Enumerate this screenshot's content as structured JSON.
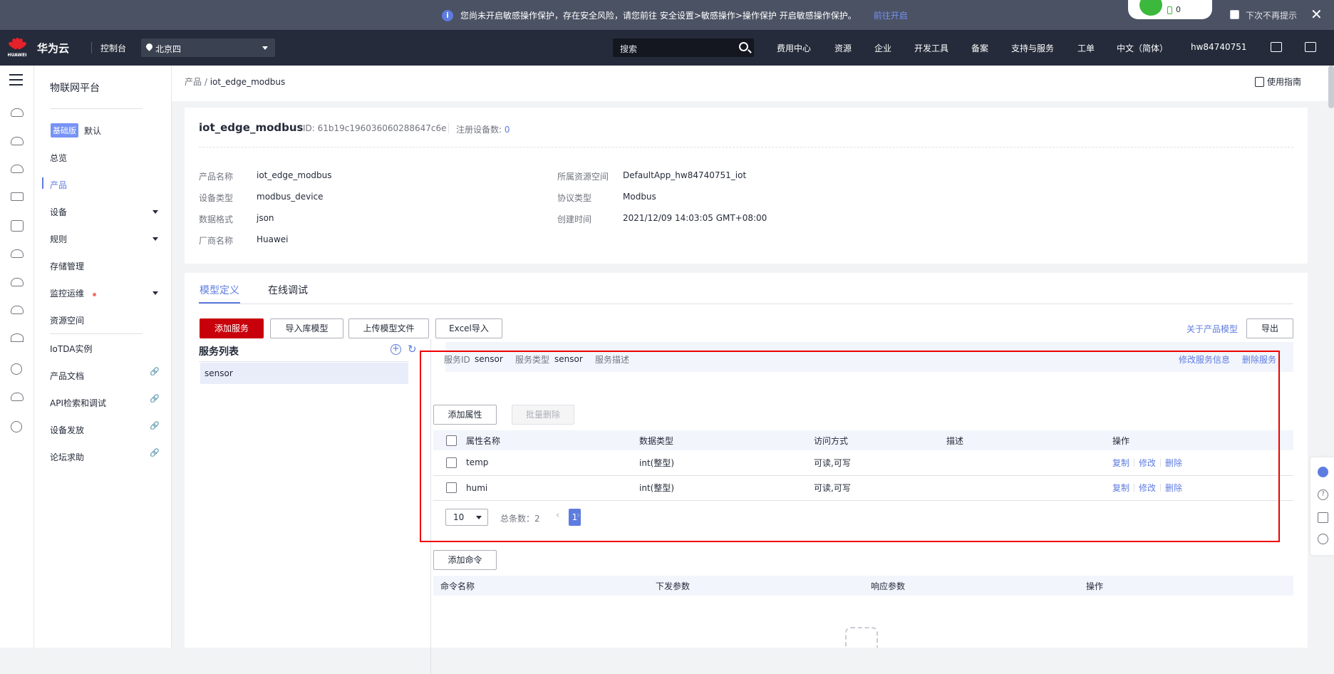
{
  "notice": {
    "message": "您尚未开启敏感操作保护，存在安全风险，请您前往 安全设置>敏感操作>操作保护 开启敏感操作保护。",
    "link": "前往开启",
    "battery_value": "0",
    "dont_remind": "下次不再提示",
    "close": "✕"
  },
  "header": {
    "brand": "华为云",
    "logo_text": "HUAWEI",
    "console": "控制台",
    "region": "北京四",
    "search_placeholder": "搜索",
    "nav": [
      "费用中心",
      "资源",
      "企业",
      "开发工具",
      "备案",
      "支持与服务",
      "工单",
      "中文（简体）",
      "hw84740751"
    ]
  },
  "sidemenu": {
    "title": "物联网平台",
    "edition_badge": "基础版",
    "edition_label": "默认",
    "items": [
      "总览",
      "产品",
      "设备",
      "规则",
      "存储管理",
      "监控运维",
      "资源空间",
      "IoTDA实例",
      "产品文档",
      "API检索和调试",
      "设备发放",
      "论坛求助"
    ]
  },
  "breadcrumb": {
    "root": "产品",
    "separator": " / ",
    "current": "iot_edge_modbus",
    "guide": "使用指南"
  },
  "product": {
    "name": "iot_edge_modbus",
    "id_text": "ID: 61b19c196036060288647c6e",
    "registered_label": "注册设备数:",
    "registered_value": "0",
    "fields_left": [
      {
        "key": "产品名称",
        "value": "iot_edge_modbus"
      },
      {
        "key": "设备类型",
        "value": "modbus_device"
      },
      {
        "key": "数据格式",
        "value": "json"
      },
      {
        "key": "厂商名称",
        "value": "Huawei"
      }
    ],
    "fields_right": [
      {
        "key": "所属资源空间",
        "value": "DefaultApp_hw84740751_iot"
      },
      {
        "key": "协议类型",
        "value": "Modbus"
      },
      {
        "key": "创建时间",
        "value": "2021/12/09 14:03:05 GMT+08:00"
      }
    ]
  },
  "tabs": [
    "模型定义",
    "在线调试"
  ],
  "toolbar": {
    "add_service": "添加服务",
    "import_model": "导入库模型",
    "upload_model": "上传模型文件",
    "excel_import": "Excel导入",
    "about_model": "关于产品模型",
    "export": "导出"
  },
  "service_list": {
    "title": "服务列表",
    "items": [
      "sensor"
    ]
  },
  "service_detail": {
    "id_label": "服务ID",
    "id_value": "sensor",
    "type_label": "服务类型",
    "type_value": "sensor",
    "desc_label": "服务描述",
    "edit": "修改服务信息",
    "delete": "删除服务",
    "add_property": "添加属性",
    "batch_delete": "批量删除",
    "columns": [
      "属性名称",
      "数据类型",
      "访问方式",
      "描述",
      "操作"
    ],
    "rows": [
      {
        "name": "temp",
        "type": "int(整型)",
        "access": "可读,可写",
        "desc": "",
        "ops": [
          "复制",
          "修改",
          "删除"
        ]
      },
      {
        "name": "humi",
        "type": "int(整型)",
        "access": "可读,可写",
        "desc": "",
        "ops": [
          "复制",
          "修改",
          "删除"
        ]
      }
    ],
    "page_size": "10",
    "total_label": "总条数：2",
    "current_page": "1",
    "add_command": "添加命令",
    "command_columns": [
      "命令名称",
      "下发参数",
      "响应参数",
      "操作"
    ]
  }
}
